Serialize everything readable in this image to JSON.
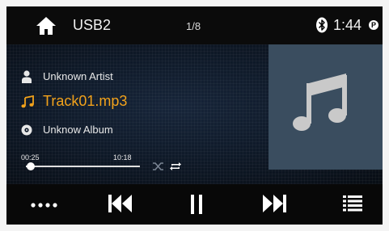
{
  "topbar": {
    "source": "USB2",
    "track_count": "1/8",
    "time": "1:44"
  },
  "track": {
    "artist": "Unknown Artist",
    "title": "Track01.mp3",
    "album": "Unknow Album"
  },
  "progress": {
    "elapsed": "00:25",
    "total": "10:18",
    "fraction": 0.04
  },
  "colors": {
    "accent": "#f2a21b",
    "art_bg": "#3a4d5f"
  },
  "icons": {
    "home": "home-icon",
    "bluetooth": "bluetooth-icon",
    "status": "p-icon",
    "artist": "person-icon",
    "title": "music-note-icon",
    "album": "disc-icon",
    "shuffle": "shuffle-icon",
    "repeat": "repeat-icon",
    "more": "more-dots-icon",
    "prev": "skip-previous-icon",
    "pause": "pause-icon",
    "next": "skip-next-icon",
    "list": "playlist-icon"
  }
}
